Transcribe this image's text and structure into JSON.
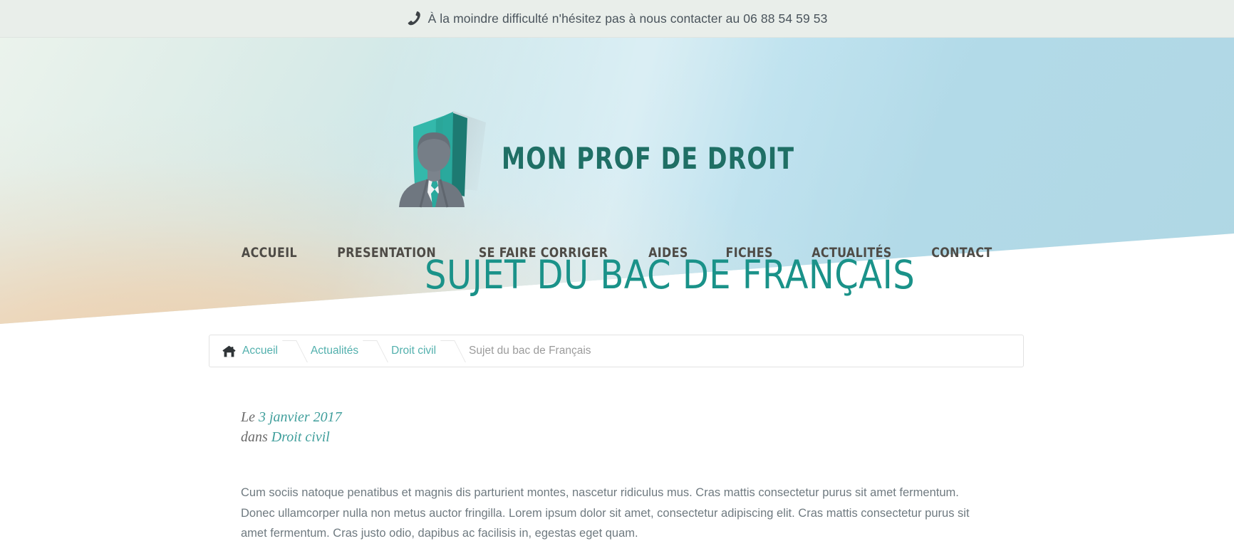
{
  "topbar": {
    "icon": "phone-icon",
    "glyph": "☎",
    "text": "À la moindre difficulté n'hésitez pas à nous contacter au 06 88 54 59 53",
    "phone_number": "06 88 54 59 53"
  },
  "brand": {
    "name": "MON PROF DE DROIT",
    "logo_icon": "book-and-professor-logo",
    "color": "#1f6f65"
  },
  "nav": {
    "items": [
      {
        "label": "ACCUEIL",
        "name": "nav-item-accueil"
      },
      {
        "label": "PRESENTATION",
        "name": "nav-item-presentation"
      },
      {
        "label": "SE FAIRE CORRIGER",
        "name": "nav-item-se-faire-corriger"
      },
      {
        "label": "AIDES",
        "name": "nav-item-aides"
      },
      {
        "label": "FICHES",
        "name": "nav-item-fiches"
      },
      {
        "label": "ACTUALITÉS",
        "name": "nav-item-actualites"
      },
      {
        "label": "CONTACT",
        "name": "nav-item-contact"
      }
    ]
  },
  "page": {
    "title": "SUJET DU BAC DE FRANÇAIS",
    "title_color": "#1a9289"
  },
  "breadcrumb": {
    "home_icon": "home-icon",
    "items": [
      {
        "label": "Accueil",
        "current": false
      },
      {
        "label": "Actualités",
        "current": false
      },
      {
        "label": "Droit civil",
        "current": false
      },
      {
        "label": "Sujet du bac de Français",
        "current": true
      }
    ]
  },
  "article": {
    "date_prefix": "Le ",
    "date": "3 janvier 2017",
    "category_prefix": "dans ",
    "category": "Droit civil",
    "paragraph": "Cum sociis natoque penatibus et magnis dis parturient montes, nascetur ridiculus mus. Cras mattis consectetur purus sit amet fermentum. Donec ullamcorper nulla non metus auctor fringilla. Lorem ipsum dolor sit amet, consectetur adipiscing elit. Cras mattis consectetur purus sit amet fermentum. Cras justo odio, dapibus ac facilisis in, egestas eget quam."
  },
  "colors": {
    "accent_teal": "#1a9289",
    "link_teal": "#52b0ad",
    "topbar_bg": "#e9eeea",
    "body_text": "#6f7a80"
  }
}
